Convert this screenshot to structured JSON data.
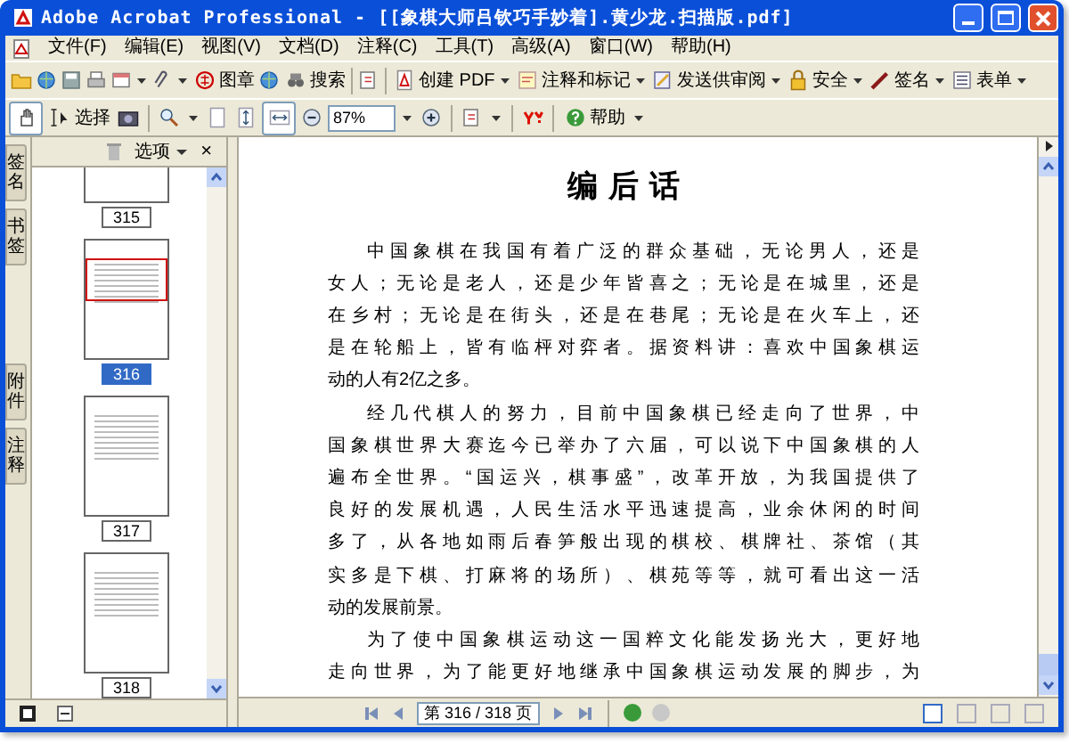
{
  "window": {
    "title": "Adobe Acrobat Professional - [[象棋大师吕钦巧手妙着].黄少龙.扫描版.pdf]"
  },
  "menu": [
    "文件(F)",
    "编辑(E)",
    "视图(V)",
    "文档(D)",
    "注释(C)",
    "工具(T)",
    "高级(A)",
    "窗口(W)",
    "帮助(H)"
  ],
  "toolbar_1": [
    {
      "label": "图章",
      "dropdown": false
    },
    {
      "label": "搜索",
      "dropdown": false
    },
    {
      "label": "创建 PDF",
      "dropdown": true
    },
    {
      "label": "注释和标记",
      "dropdown": true
    },
    {
      "label": "发送供审阅",
      "dropdown": true
    },
    {
      "label": "安全",
      "dropdown": true
    },
    {
      "label": "签名",
      "dropdown": true
    },
    {
      "label": "表单",
      "dropdown": true
    }
  ],
  "toolbar_2": {
    "select_label": "选择",
    "zoom": "87%",
    "help_label": "帮助"
  },
  "side_tabs": [
    {
      "label": "签名",
      "selected": false
    },
    {
      "label": "书签",
      "selected": false
    },
    {
      "label": "附件",
      "selected": false
    },
    {
      "label": "注释",
      "selected": false
    }
  ],
  "thumbnails": {
    "options_label": "选项",
    "close": "×",
    "pages": [
      {
        "label": "315",
        "selected": false
      },
      {
        "label": "316",
        "selected": true
      },
      {
        "label": "317",
        "selected": false
      },
      {
        "label": "318",
        "selected": false
      }
    ]
  },
  "document": {
    "heading": "编 后 话",
    "paragraphs": [
      {
        "lines": [
          "中国象棋在我国有着广泛的群众基础，无论男人，还是",
          "女人；无论是老人，还是少年皆喜之；无论是在城里，还是",
          "在乡村；无论是在街头，还是在巷尾；无论是在火车上，还",
          "是在轮船上，皆有临枰对弈者。据资料讲：喜欢中国象棋运",
          "动的人有2亿之多。"
        ]
      },
      {
        "lines": [
          "经几代棋人的努力，目前中国象棋已经走向了世界，中",
          "国象棋世界大赛迄今已举办了六届，可以说下中国象棋的人",
          "遍布全世界。“国运兴，棋事盛”，改革开放，为我国提供了",
          "良好的发展机遇，人民生活水平迅速提高，业余休闲的时间",
          "多了，从各地如雨后春笋般出现的棋校、棋牌社、茶馆（其",
          "实多是下棋、打麻将的场所）、棋苑等等，就可看出这一活",
          "动的发展前景。"
        ]
      },
      {
        "lines": [
          "为了使中国象棋运动这一国粹文化能发扬光大，更好地",
          "走向世界，为了能更好地继承中国象棋运动发展的脚步，为"
        ]
      }
    ]
  },
  "status_bar": {
    "page_field": "第 316 / 318 页"
  }
}
